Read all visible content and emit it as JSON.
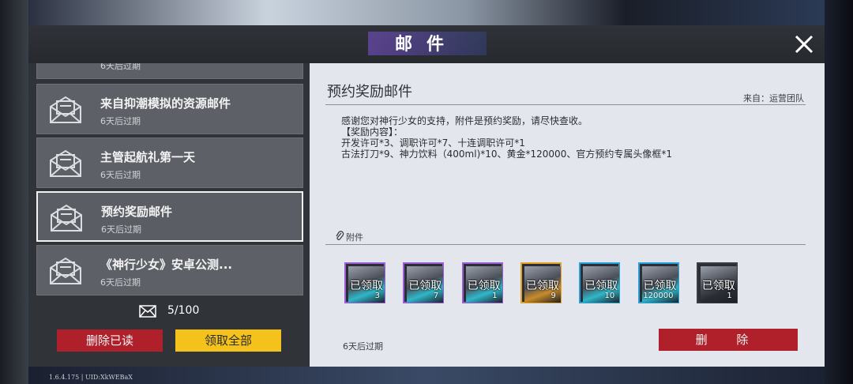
{
  "modal": {
    "title": "邮件"
  },
  "footer": {
    "version": "1.6.4.175 | UID:XkWEBaX"
  },
  "mail_list": {
    "items": [
      {
        "title": "",
        "expiry": "6天后过期"
      },
      {
        "title": "来自抑潮模拟的资源邮件",
        "expiry": "6天后过期"
      },
      {
        "title": "主管起航礼第一天",
        "expiry": "6天后过期"
      },
      {
        "title": "预约奖励邮件",
        "expiry": "6天后过期",
        "selected": true
      },
      {
        "title": "《神行少女》安卓公测...",
        "expiry": "6天后过期"
      }
    ],
    "count": "5/100",
    "delete_read_label": "删除已读",
    "claim_all_label": "领取全部"
  },
  "detail": {
    "title": "预约奖励邮件",
    "from": "来自：运营团队",
    "body": [
      "感谢您对神行少女的支持，附件是预约奖励，请尽快查收。",
      "【奖励内容】：",
      "开发许可*3、调职许可*7、十连调职许可*1",
      "古法打刀*9、神力饮料（400ml)*10、黄金*120000、官方预约专属头像框*1"
    ],
    "attachment_label": "附件",
    "attachments": [
      {
        "status": "已领取",
        "qty": "3",
        "frame_color": "#9b5cd6",
        "fill_color": "#2fb7c9"
      },
      {
        "status": "已领取",
        "qty": "7",
        "frame_color": "#9b5cd6",
        "fill_color": "#2fb7c9"
      },
      {
        "status": "已领取",
        "qty": "1",
        "frame_color": "#9b5cd6",
        "fill_color": "#2fb7c9"
      },
      {
        "status": "已领取",
        "qty": "9",
        "frame_color": "#e2a12b",
        "fill_color": "#c98b2a"
      },
      {
        "status": "已领取",
        "qty": "10",
        "frame_color": "#2a9fd8",
        "fill_color": "#2fb7c9"
      },
      {
        "status": "已领取",
        "qty": "120000",
        "frame_color": "#2a9fd8",
        "fill_color": "#2fb7c9"
      },
      {
        "status": "已领取",
        "qty": "1",
        "frame_color": "#3a3d44",
        "fill_color": "#2a2c33"
      }
    ],
    "expiry": "6天后过期",
    "delete_label": "删 除"
  },
  "colors": {
    "accent_red": "#b0202a",
    "accent_yellow": "#f4c21a"
  }
}
